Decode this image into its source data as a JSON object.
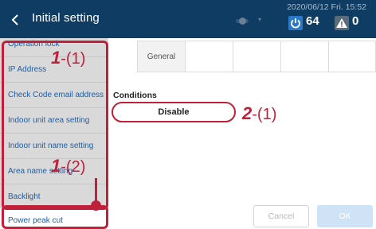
{
  "header": {
    "title": "Initial setting",
    "datetime": "2020/06/12 Fri. 15:52",
    "power_count": "64",
    "warning_count": "0",
    "toggle_caret": "▾",
    "icons": [
      "chevron-left-icon",
      "toggle-icon",
      "power-icon",
      "warning-icon"
    ]
  },
  "sidebar": {
    "items": [
      {
        "label": "Operation lock"
      },
      {
        "label": "IP Address"
      },
      {
        "label": "Check Code email address"
      },
      {
        "label": "Indoor unit area setting"
      },
      {
        "label": "Indoor unit name setting"
      },
      {
        "label": "Area name setting"
      },
      {
        "label": "Backlight"
      },
      {
        "label": "Power peak cut"
      }
    ],
    "active_item": "Power peak cut"
  },
  "callouts": {
    "c1": {
      "num": "1",
      "rest": "-(1)"
    },
    "c2": {
      "num": "1",
      "rest": "-(2)"
    },
    "c3": {
      "num": "2",
      "rest": "-(1)"
    }
  },
  "tabs": [
    "General",
    "",
    "",
    "",
    ""
  ],
  "conditions": {
    "label": "Conditions",
    "value": "Disable"
  },
  "buttons": {
    "cancel": "Cancel",
    "ok": "OK"
  },
  "colors": {
    "header_bg": "#0f3c63",
    "annotation_red": "#c0203a",
    "sidebar_bg": "#d9d9d9",
    "link_blue": "#1e5fa8"
  }
}
